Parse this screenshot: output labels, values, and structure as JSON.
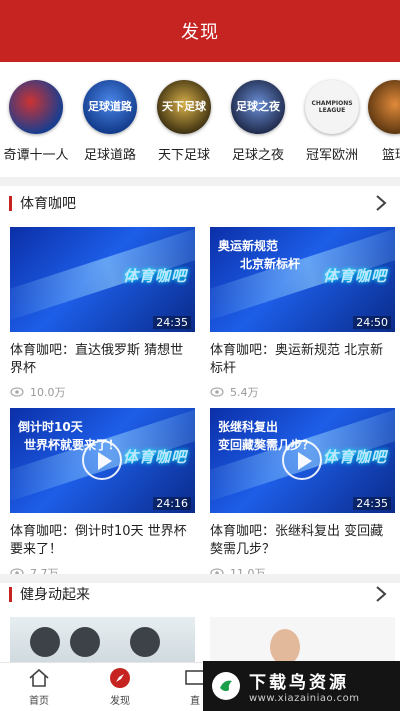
{
  "header": {
    "title": "发现"
  },
  "channels": [
    {
      "label": "奇谭十一人",
      "logo_text": "",
      "bg": "#1a3d8f"
    },
    {
      "label": "足球道路",
      "logo_text": "足球道路",
      "bg": "#2356b8"
    },
    {
      "label": "天下足球",
      "logo_text": "天下足球",
      "bg": "#6a5a2a"
    },
    {
      "label": "足球之夜",
      "logo_text": "足球之夜",
      "bg": "#2f3d66"
    },
    {
      "label": "冠军欧洲",
      "logo_text": "CHAMPIONS LEAGUE",
      "bg": "#f2f2f2"
    },
    {
      "label": "篮球",
      "logo_text": "",
      "bg": "#8a5a2a"
    }
  ],
  "sections": [
    {
      "title": "体育咖吧"
    },
    {
      "title": "健身动起来"
    }
  ],
  "videos": [
    {
      "title": "体育咖吧：直达俄罗斯 猜想世界杯",
      "views": "10.0万",
      "duration": "24:35",
      "cap1": "",
      "cap2": "",
      "brand": "体育咖吧"
    },
    {
      "title": "体育咖吧：奥运新规范 北京新标杆",
      "views": "5.4万",
      "duration": "24:50",
      "cap1": "奥运新规范",
      "cap2": "北京新标杆",
      "brand": "体育咖吧"
    },
    {
      "title": "体育咖吧：倒计时10天 世界杯要来了！",
      "views": "7.7万",
      "duration": "24:16",
      "cap1": "倒计时10天",
      "cap2": "世界杯就要来了！",
      "brand": "体育咖吧"
    },
    {
      "title": "体育咖吧：张继科复出 变回藏獒需几步？",
      "views": "11.0万",
      "duration": "24:35",
      "cap1": "张继科复出",
      "cap2": "变回藏獒需几步？",
      "brand": "体育咖吧"
    }
  ],
  "tabbar": [
    {
      "label": "首页",
      "icon": "home-icon"
    },
    {
      "label": "发现",
      "icon": "compass-icon"
    },
    {
      "label": "直",
      "icon": "tv-icon"
    }
  ],
  "watermark": {
    "name": "下载鸟资源",
    "url": "www.xiazainiao.com"
  },
  "colors": {
    "accent": "#c52421",
    "divider": "#f1f1f1"
  }
}
